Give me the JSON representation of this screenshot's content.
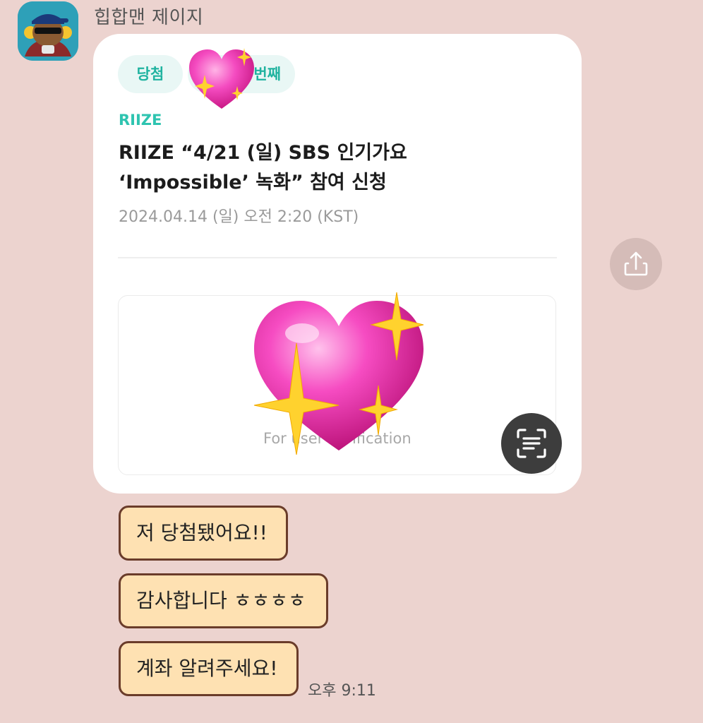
{
  "sender": {
    "name": "힙합맨 제이지"
  },
  "card": {
    "chip_result": "당첨",
    "chip_order": "번째",
    "brand": "RIIZE",
    "title": "RIIZE “4/21 (일) SBS 인기가요 ‘Impossible’ 녹화” 참여 신청",
    "date": "2024.04.14 (일) 오전 2:20 (KST)",
    "verification_text": "For user verification",
    "accent_color": "#2ec4b0"
  },
  "messages": [
    {
      "text": "저 당첨됐어요!!"
    },
    {
      "text": "감사합니다 ㅎㅎㅎㅎ"
    },
    {
      "text": "계좌 알려주세요!"
    }
  ],
  "timestamp": "오후 9:11",
  "icons": {
    "share": "share-icon",
    "scan": "text-scan-icon",
    "sticker": "sparkling-heart-emoji"
  },
  "colors": {
    "chat_background": "#ecd3cf",
    "bubble_fill": "#fee1b2",
    "bubble_border": "#6a3c2a"
  }
}
